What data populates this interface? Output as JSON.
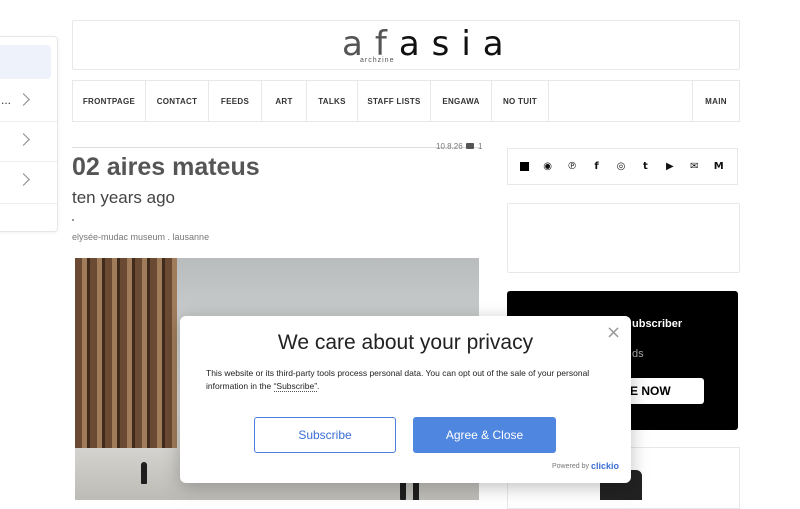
{
  "header": {
    "logo_prefix": "af",
    "logo_main": "asia",
    "logo_sub": "archzine"
  },
  "nav": {
    "items": [
      "FRONTPAGE",
      "CONTACT",
      "FEEDS",
      "ART",
      "TALKS",
      "STAFF LISTS",
      "ENGAWA",
      "NO TUIT"
    ],
    "main": "MAIN"
  },
  "side_panel": {
    "dots": "..."
  },
  "article": {
    "date": "10.8.26",
    "comment_count": "1",
    "title": "02 aires mateus",
    "subtitle": "ten years ago",
    "caption": "elysée-mudac museum . lausanne"
  },
  "social_icons": [
    "square-icon",
    "rss-icon",
    "pinterest-icon",
    "facebook-icon",
    "instagram-icon",
    "tumblr-icon",
    "youtube-icon",
    "mail-icon",
    "gmail-icon"
  ],
  "promo": {
    "title": "ubscriber",
    "text": "ds",
    "button": "E NOW"
  },
  "privacy_modal": {
    "title": "We care about your privacy",
    "text_before": "This website or its third-party tools process personal data. You can opt out of the sale of your personal information in the ",
    "link": "“Subscribe”",
    "text_after": ".",
    "subscribe_button": "Subscribe",
    "agree_button": "Agree & Close",
    "close": "×",
    "powered_by": "Powered by",
    "brand": "clickio"
  },
  "colors": {
    "accent": "#4f86e0",
    "promo_bg": "#000000"
  }
}
